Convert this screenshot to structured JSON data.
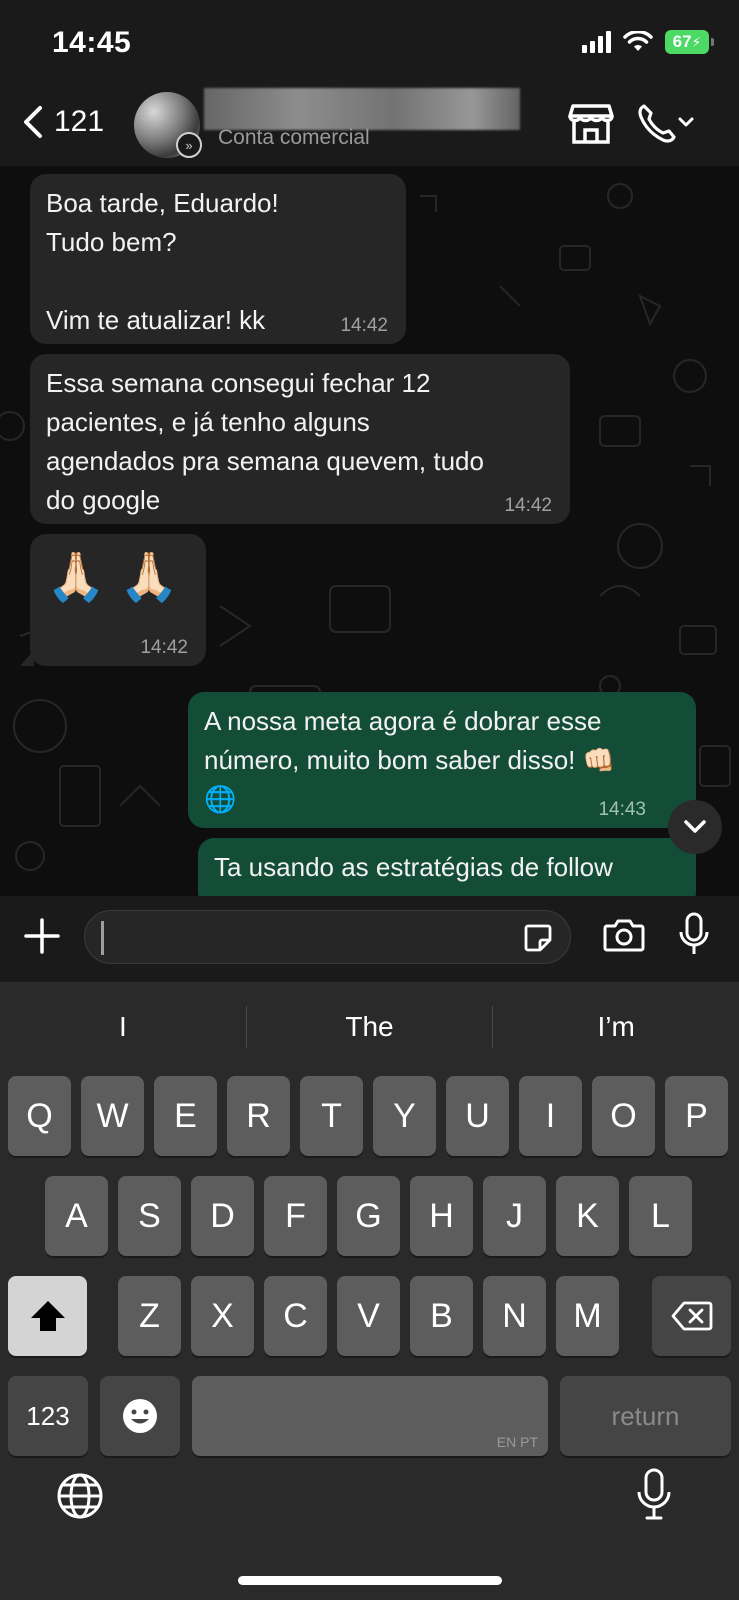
{
  "status_bar": {
    "time": "14:45",
    "battery": "67"
  },
  "header": {
    "unread_count": "121",
    "subtitle": "Conta comercial"
  },
  "messages": [
    {
      "direction": "in",
      "text": "Boa tarde, Eduardo!\nTudo bem?\n\nVim te atualizar! kk",
      "time": "14:42"
    },
    {
      "direction": "in",
      "text": "Essa semana consegui fechar 12\npacientes, e já tenho alguns\nagendados pra semana quevem, tudo\ndo google",
      "time": "14:42"
    },
    {
      "direction": "in",
      "text": "🙏🏻 🙏🏻",
      "time": "14:42"
    },
    {
      "direction": "out",
      "text": "A nossa meta agora é dobrar esse\nnúmero, muito bom saber disso! 👊🏻\n🌐",
      "time": "14:43"
    },
    {
      "direction": "out",
      "text": "Ta usando as estratégias de follow",
      "time": ""
    }
  ],
  "input": {
    "value": ""
  },
  "keyboard": {
    "suggestions": [
      "I",
      "The",
      "I’m"
    ],
    "row1": [
      "Q",
      "W",
      "E",
      "R",
      "T",
      "Y",
      "U",
      "I",
      "O",
      "P"
    ],
    "row2": [
      "A",
      "S",
      "D",
      "F",
      "G",
      "H",
      "J",
      "K",
      "L"
    ],
    "row3": [
      "Z",
      "X",
      "C",
      "V",
      "B",
      "N",
      "M"
    ],
    "numbers_label": "123",
    "space_language": "EN PT",
    "return_label": "return"
  }
}
